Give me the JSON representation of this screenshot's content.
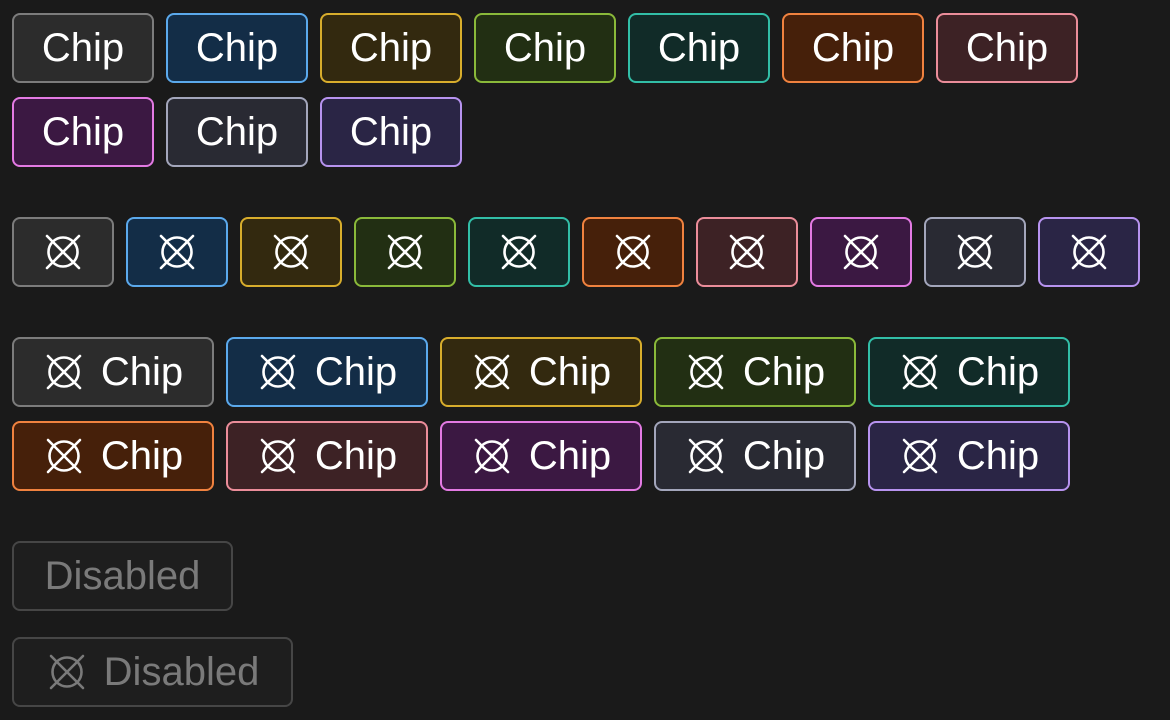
{
  "label_chip": "Chip",
  "label_disabled": "Disabled",
  "icon_name": "crossed-circle-icon",
  "variants": [
    {
      "name": "default",
      "border": "#7c7c7c",
      "fill": "#2c2c2c"
    },
    {
      "name": "blue",
      "border": "#5ba9ec",
      "fill": "#132d47"
    },
    {
      "name": "yellow",
      "border": "#d8ad2c",
      "fill": "#33290f"
    },
    {
      "name": "green",
      "border": "#8ab93a",
      "fill": "#222f13"
    },
    {
      "name": "teal",
      "border": "#32bea7",
      "fill": "#112b28"
    },
    {
      "name": "orange",
      "border": "#f0823f",
      "fill": "#46200a"
    },
    {
      "name": "red",
      "border": "#eb8d9a",
      "fill": "#3d2225"
    },
    {
      "name": "magenta",
      "border": "#e37ae3",
      "fill": "#3b1842"
    },
    {
      "name": "slate",
      "border": "#a3a6bb",
      "fill": "#292a33"
    },
    {
      "name": "purple",
      "border": "#b793ef",
      "fill": "#2a2545"
    }
  ],
  "disabled_colors": {
    "border": "#464646",
    "fill": "#1e1e1e",
    "text": "#7a7a7a"
  }
}
